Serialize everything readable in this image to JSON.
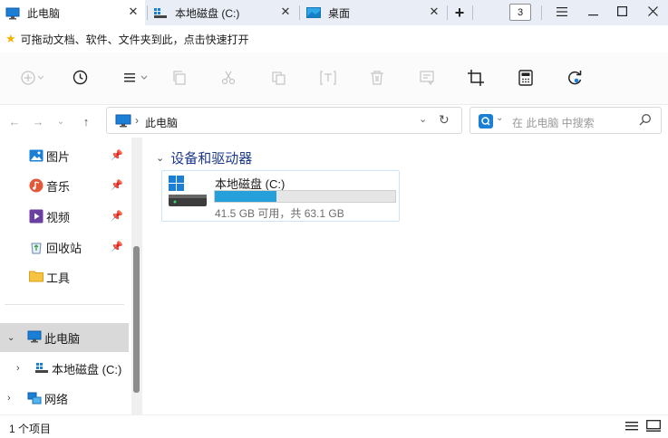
{
  "tabs": [
    {
      "label": "此电脑",
      "icon": "monitor-icon",
      "active": true
    },
    {
      "label": "本地磁盘 (C:)",
      "icon": "drive-icon",
      "active": false
    },
    {
      "label": "桌面",
      "icon": "desktop-icon",
      "active": false
    }
  ],
  "tab_count": "3",
  "favbar": {
    "hint": "可拖动文档、软件、文件夹到此，点击快速打开"
  },
  "toolbar_icons": [
    "new-icon",
    "history-icon",
    "view-icon",
    "copy-icon",
    "cut-icon",
    "paste-icon",
    "rename-icon",
    "delete-icon",
    "properties-icon",
    "crop-icon",
    "calculator-icon",
    "refresh-icon"
  ],
  "address": {
    "path_label": "此电脑",
    "separator": "›"
  },
  "search": {
    "placeholder": "在 此电脑 中搜索"
  },
  "sidebar": {
    "quick": [
      {
        "label": "图片",
        "icon": "pictures-icon",
        "pinned": true
      },
      {
        "label": "音乐",
        "icon": "music-icon",
        "pinned": true
      },
      {
        "label": "视频",
        "icon": "video-icon",
        "pinned": true
      },
      {
        "label": "回收站",
        "icon": "recycle-bin-icon",
        "pinned": true
      },
      {
        "label": "工具",
        "icon": "folder-icon",
        "pinned": false
      }
    ],
    "tree": [
      {
        "label": "此电脑",
        "icon": "monitor-icon",
        "expanded": true,
        "selected": true
      },
      {
        "label": "本地磁盘 (C:)",
        "icon": "drive-icon",
        "expanded": false
      },
      {
        "label": "网络",
        "icon": "network-icon",
        "expanded": false
      }
    ]
  },
  "main": {
    "group_label": "设备和驱动器",
    "drives": [
      {
        "name": "本地磁盘 (C:)",
        "usage_text": "41.5 GB 可用，共 63.1 GB",
        "used_fraction": 0.342
      }
    ]
  },
  "status": {
    "items": "1 个项目"
  },
  "colors": {
    "accent": "#26a0da",
    "selection": "#d9d9d9",
    "tabbar": "#e9eef6"
  }
}
